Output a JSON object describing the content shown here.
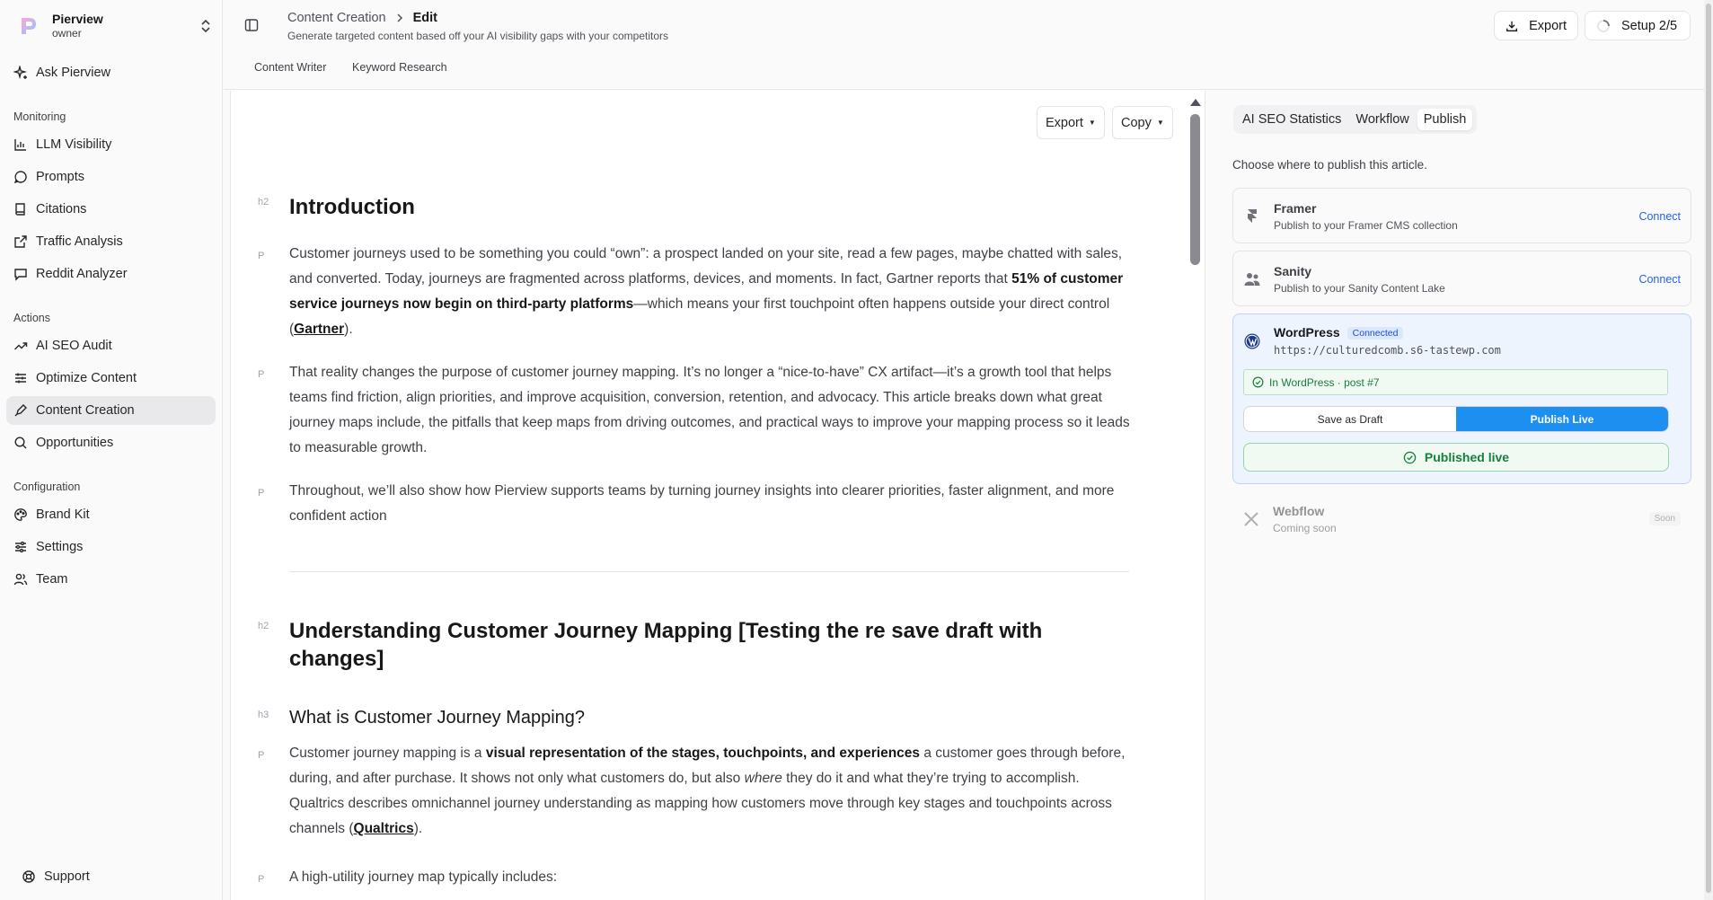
{
  "app": {
    "name": "Pierview",
    "role": "owner"
  },
  "sidebar": {
    "top_item": "Ask Pierview",
    "sections": [
      {
        "title": "Monitoring",
        "items": [
          "LLM Visibility",
          "Prompts",
          "Citations",
          "Traffic Analysis",
          "Reddit Analyzer"
        ]
      },
      {
        "title": "Actions",
        "items": [
          "AI SEO Audit",
          "Optimize Content",
          "Content Creation",
          "Opportunities"
        ]
      },
      {
        "title": "Configuration",
        "items": [
          "Brand Kit",
          "Settings",
          "Team"
        ]
      }
    ],
    "active_item": "Content Creation",
    "support": "Support"
  },
  "header": {
    "breadcrumb": [
      "Content Creation",
      "Edit"
    ],
    "subtitle": "Generate targeted content based off your AI visibility gaps with your competitors",
    "export_label": "Export",
    "setup_label": "Setup 2/5",
    "tabs": [
      "Content Writer",
      "Keyword Research"
    ]
  },
  "editor": {
    "export_label": "Export",
    "copy_label": "Copy",
    "tags": {
      "h2": "h2",
      "h3": "h3",
      "p": "P"
    },
    "intro_heading": "Introduction",
    "intro_p1_a": "Customer journeys used to be something you could “own”: a prospect landed on your site, read a few pages, maybe chatted with sales, and converted. Today, journeys are fragmented across platforms, devices, and moments. In fact, Gartner reports that ",
    "intro_p1_bold": "51% of customer service journeys now begin on third-party platforms",
    "intro_p1_b": "—which means your first touchpoint often happens outside your direct control (",
    "intro_p1_link": "Gartner",
    "intro_p1_c": ").",
    "intro_p2": "That reality changes the purpose of customer journey mapping. It’s no longer a “nice-to-have” CX artifact—it’s a growth tool that helps teams find friction, align priorities, and improve acquisition, conversion, retention, and advocacy. This article breaks down what great journey maps include, the pitfalls that keep maps from driving outcomes, and practical ways to improve your mapping process so it leads to measurable growth.",
    "intro_p3": "Throughout, we’ll also show how Pierview supports teams by turning journey insights into clearer priorities, faster alignment, and more confident action",
    "section2_heading": "Understanding Customer Journey Mapping [Testing the re save draft with changes]",
    "section2_sub": "What is Customer Journey Mapping?",
    "s2_p1_a": "Customer journey mapping is a ",
    "s2_p1_bold": "visual representation of the stages, touchpoints, and experiences",
    "s2_p1_b": " a customer goes through before, during, and after purchase. It shows not only what customers do, but also ",
    "s2_p1_em": "where",
    "s2_p1_c": " they do it and what they’re trying to accomplish. Qualtrics describes omnichannel journey understanding as mapping how customers move through key stages and touchpoints across channels (",
    "s2_p1_link": "Qualtrics",
    "s2_p1_d": ").",
    "s2_p2": "A high-utility journey map typically includes:"
  },
  "panel": {
    "tabs": [
      "AI SEO Statistics",
      "Workflow",
      "Publish"
    ],
    "active_tab": "Publish",
    "intro": "Choose where to publish this article.",
    "framer": {
      "name": "Framer",
      "desc": "Publish to your Framer CMS collection",
      "action": "Connect"
    },
    "sanity": {
      "name": "Sanity",
      "desc": "Publish to your Sanity Content Lake",
      "action": "Connect"
    },
    "wordpress": {
      "name": "WordPress",
      "badge": "Connected",
      "url": "https://culturedcomb.s6-tastewp.com",
      "status": "In WordPress · post #7",
      "draft_label": "Save as Draft",
      "live_label": "Publish Live",
      "published_label": "Published live"
    },
    "webflow": {
      "name": "Webflow",
      "desc": "Coming soon",
      "badge": "Soon"
    }
  },
  "colors": {
    "accent": "#1d8ff1",
    "success": "#15803d",
    "link": "#2563eb"
  }
}
